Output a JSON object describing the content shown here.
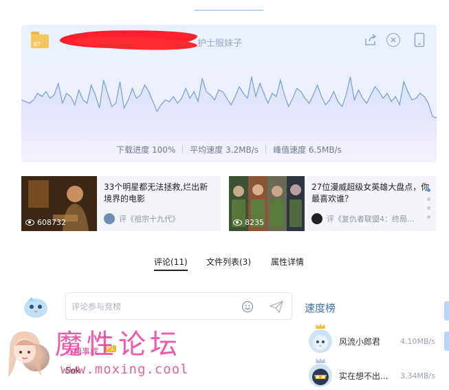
{
  "header": {
    "title_visible_tail": "护士服妹子"
  },
  "file": {
    "type_badge": "BT"
  },
  "graph": {
    "series": [
      34,
      32,
      30,
      34,
      42,
      38,
      44,
      36,
      40,
      54,
      30,
      42,
      38,
      28,
      46,
      34,
      30,
      52,
      40,
      24,
      58,
      42,
      26,
      30,
      56,
      24,
      34,
      48,
      36,
      40,
      52,
      44,
      32,
      20,
      28,
      34,
      32,
      38,
      30,
      36,
      48,
      36,
      44,
      32,
      60,
      44,
      40,
      34,
      46,
      44,
      36,
      28,
      38,
      50,
      42,
      36,
      62,
      38,
      54,
      42,
      30,
      42,
      38,
      58,
      40,
      26,
      36,
      48,
      44,
      36,
      30,
      40,
      52,
      38,
      28,
      34,
      44,
      32,
      26,
      40,
      62,
      34,
      46,
      36,
      30,
      40,
      50,
      44,
      36,
      42,
      32,
      38,
      28,
      56,
      44,
      34,
      36,
      42,
      38,
      30,
      14,
      12
    ],
    "stroke": "#6e9fd6",
    "fill_top": "#d9e2fb",
    "fill_bottom": "#ece9fb"
  },
  "stats": {
    "progress_label": "下载进度 100%",
    "avg_label": "平均速度 3.2MB/s",
    "peak_label": "峰值速度 6.5MB/s"
  },
  "recommendations": [
    {
      "title": "33个明星都无法拯救,烂出新境界的电影",
      "views": "608732",
      "review": "评《祖宗十九代》"
    },
    {
      "title": "27位漫威超级女英雄大盘点，你最喜欢谁？",
      "views": "8235",
      "review": "评《复仇者联盟4：终局..."
    }
  ],
  "tabs": [
    {
      "label": "评论(11)",
      "active": true
    },
    {
      "label": "文件列表(3)",
      "active": false
    },
    {
      "label": "属性详情",
      "active": false
    }
  ],
  "comment": {
    "placeholder": "评论参与竞榜"
  },
  "speed_rank": {
    "title": "速度榜",
    "entries": [
      {
        "rank": "1",
        "name": "风流小郎君",
        "speed": "4.10MB/s"
      },
      {
        "rank": "2",
        "name": "实在想不出...",
        "speed": "3.34MB/s"
      }
    ]
  },
  "first_comment": {
    "user": "心想事成",
    "badge": "P1",
    "text": "5ok"
  },
  "watermark": {
    "text": "魔性论坛",
    "url": "www.moxing.cool"
  },
  "colors": {
    "accent": "#3d6fb8",
    "redaction": "#ff1f2c",
    "watermark": "#ec3d9a"
  }
}
